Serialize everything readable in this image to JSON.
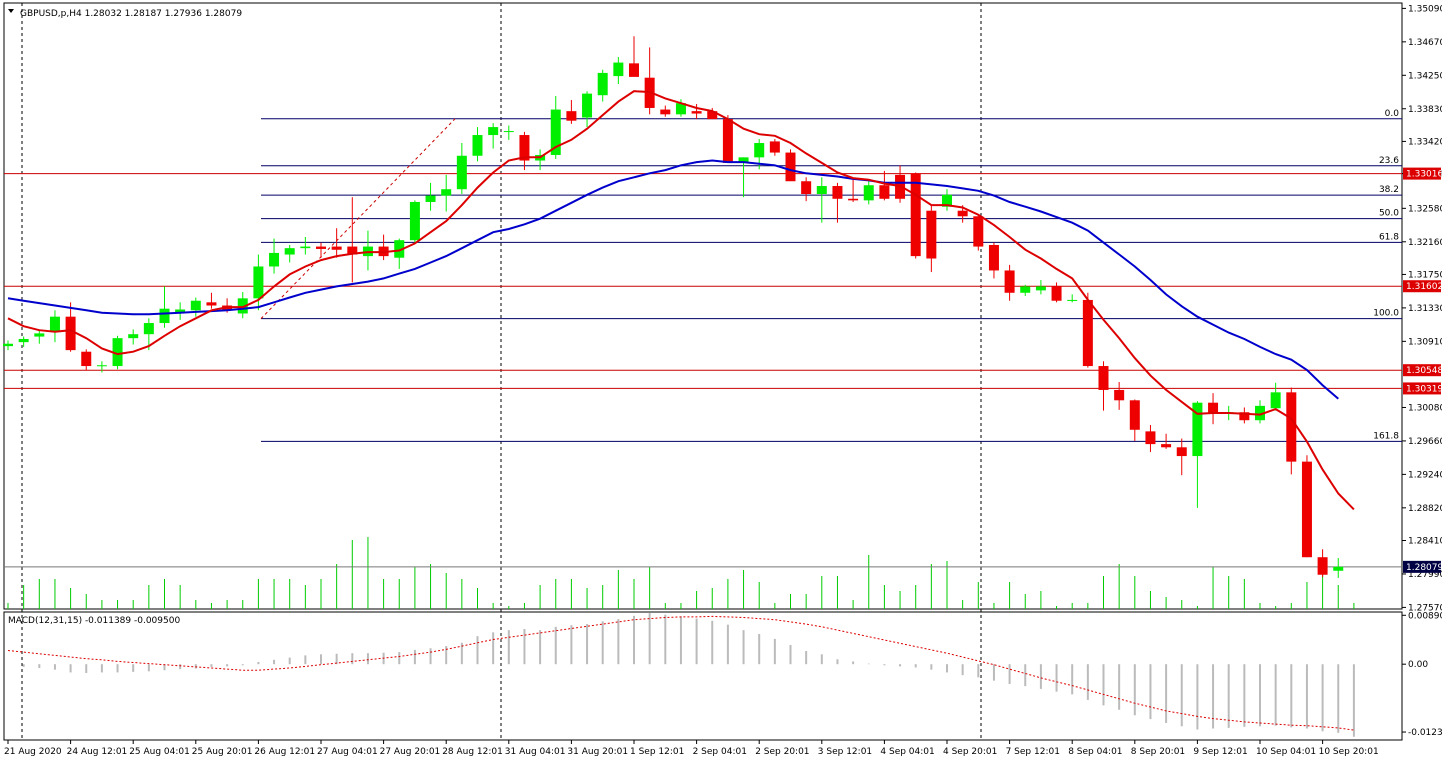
{
  "header": {
    "symbol_line": "GBPUSD,p,H4  1.28032 1.28187 1.27936 1.28079",
    "macd_line": "MACD(12,31,15) -0.011389 -0.009500"
  },
  "colors": {
    "bull": "#00ee00",
    "bear": "#ee0000",
    "ma_fast": "#dd0000",
    "ma_slow": "#0000cc",
    "fib": "#000066",
    "hline": "#cc0000",
    "volume": "#00cc00",
    "macd_hist": "#bbbbbb",
    "macd_signal": "#dd0000"
  },
  "chart_data": {
    "type": "candlestick",
    "timeframe": "H4",
    "price_axis": {
      "ticks": [
        "1.35090",
        "1.34670",
        "1.34250",
        "1.33830",
        "1.33420",
        "1.33016",
        "1.32580",
        "1.32160",
        "1.31750",
        "1.31330",
        "1.30910",
        "1.30080",
        "1.29660",
        "1.29240",
        "1.28820",
        "1.28410",
        "1.27990",
        "1.27570"
      ],
      "range": [
        1.2755,
        1.3512
      ]
    },
    "price_tags": [
      {
        "value": 1.33016,
        "label": "1.33016",
        "kind": "hline"
      },
      {
        "value": 1.31602,
        "label": "1.31602",
        "kind": "hline"
      },
      {
        "value": 1.30548,
        "label": "1.30548",
        "kind": "hline"
      },
      {
        "value": 1.30319,
        "label": "1.30319",
        "kind": "hline"
      },
      {
        "value": 1.28079,
        "label": "1.28079",
        "kind": "bid"
      }
    ],
    "fibonacci": {
      "start": 1.31195,
      "end": 1.33704,
      "levels": [
        {
          "label": "0.0",
          "value": 1.33704
        },
        {
          "label": "23.6",
          "value": 1.33114
        },
        {
          "label": "38.2",
          "value": 1.32746
        },
        {
          "label": "50.0",
          "value": 1.3245
        },
        {
          "label": "61.8",
          "value": 1.32153
        },
        {
          "label": "100.0",
          "value": 1.31195
        },
        {
          "label": "161.8",
          "value": 1.29654
        }
      ]
    },
    "x_labels": [
      {
        "label": "21 Aug 2020",
        "bar": 0
      },
      {
        "label": "24 Aug 12:01",
        "bar": 4
      },
      {
        "label": "25 Aug 04:01",
        "bar": 8
      },
      {
        "label": "25 Aug 20:01",
        "bar": 12
      },
      {
        "label": "26 Aug 12:01",
        "bar": 16
      },
      {
        "label": "27 Aug 04:01",
        "bar": 20
      },
      {
        "label": "27 Aug 20:01",
        "bar": 24
      },
      {
        "label": "28 Aug 12:01",
        "bar": 28
      },
      {
        "label": "31 Aug 04:01",
        "bar": 32
      },
      {
        "label": "31 Aug 20:01",
        "bar": 36
      },
      {
        "label": "1 Sep 12:01",
        "bar": 40
      },
      {
        "label": "2 Sep 04:01",
        "bar": 44
      },
      {
        "label": "2 Sep 20:01",
        "bar": 48
      },
      {
        "label": "3 Sep 12:01",
        "bar": 52
      },
      {
        "label": "4 Sep 04:01",
        "bar": 56
      },
      {
        "label": "4 Sep 20:01",
        "bar": 60
      },
      {
        "label": "7 Sep 12:01",
        "bar": 64
      },
      {
        "label": "8 Sep 04:01",
        "bar": 68
      },
      {
        "label": "8 Sep 20:01",
        "bar": 72
      },
      {
        "label": "9 Sep 12:01",
        "bar": 76
      },
      {
        "label": "10 Sep 04:01",
        "bar": 80
      },
      {
        "label": "10 Sep 20:01",
        "bar": 84
      }
    ],
    "candles": [
      {
        "o": 1.3085,
        "h": 1.3092,
        "l": 1.308,
        "c": 1.3088
      },
      {
        "o": 1.309,
        "h": 1.3097,
        "l": 1.3084,
        "c": 1.3094
      },
      {
        "o": 1.3097,
        "h": 1.3106,
        "l": 1.3088,
        "c": 1.3101
      },
      {
        "o": 1.3103,
        "h": 1.313,
        "l": 1.309,
        "c": 1.3122
      },
      {
        "o": 1.3122,
        "h": 1.314,
        "l": 1.3078,
        "c": 1.308
      },
      {
        "o": 1.3078,
        "h": 1.3081,
        "l": 1.3055,
        "c": 1.306
      },
      {
        "o": 1.306,
        "h": 1.3066,
        "l": 1.3052,
        "c": 1.3061
      },
      {
        "o": 1.306,
        "h": 1.3098,
        "l": 1.3056,
        "c": 1.3095
      },
      {
        "o": 1.3095,
        "h": 1.3106,
        "l": 1.3087,
        "c": 1.31
      },
      {
        "o": 1.31,
        "h": 1.312,
        "l": 1.308,
        "c": 1.3114
      },
      {
        "o": 1.3114,
        "h": 1.316,
        "l": 1.3108,
        "c": 1.3132
      },
      {
        "o": 1.3127,
        "h": 1.314,
        "l": 1.3118,
        "c": 1.3131
      },
      {
        "o": 1.313,
        "h": 1.3146,
        "l": 1.3122,
        "c": 1.3142
      },
      {
        "o": 1.314,
        "h": 1.3152,
        "l": 1.3132,
        "c": 1.3136
      },
      {
        "o": 1.3136,
        "h": 1.3145,
        "l": 1.3127,
        "c": 1.313
      },
      {
        "o": 1.3126,
        "h": 1.3153,
        "l": 1.312,
        "c": 1.3145
      },
      {
        "o": 1.3145,
        "h": 1.32,
        "l": 1.313,
        "c": 1.3185
      },
      {
        "o": 1.3185,
        "h": 1.322,
        "l": 1.3176,
        "c": 1.3202
      },
      {
        "o": 1.32,
        "h": 1.3212,
        "l": 1.319,
        "c": 1.3208
      },
      {
        "o": 1.3208,
        "h": 1.3222,
        "l": 1.32,
        "c": 1.321
      },
      {
        "o": 1.321,
        "h": 1.3215,
        "l": 1.3196,
        "c": 1.3207
      },
      {
        "o": 1.321,
        "h": 1.3233,
        "l": 1.3196,
        "c": 1.3206
      },
      {
        "o": 1.321,
        "h": 1.3272,
        "l": 1.3165,
        "c": 1.32
      },
      {
        "o": 1.3198,
        "h": 1.323,
        "l": 1.318,
        "c": 1.321
      },
      {
        "o": 1.321,
        "h": 1.3225,
        "l": 1.3193,
        "c": 1.3198
      },
      {
        "o": 1.3196,
        "h": 1.322,
        "l": 1.3182,
        "c": 1.3218
      },
      {
        "o": 1.3218,
        "h": 1.3268,
        "l": 1.3214,
        "c": 1.3266
      },
      {
        "o": 1.3266,
        "h": 1.329,
        "l": 1.3255,
        "c": 1.3274
      },
      {
        "o": 1.3274,
        "h": 1.33,
        "l": 1.3254,
        "c": 1.3282
      },
      {
        "o": 1.3282,
        "h": 1.334,
        "l": 1.3276,
        "c": 1.3324
      },
      {
        "o": 1.3324,
        "h": 1.336,
        "l": 1.3317,
        "c": 1.335
      },
      {
        "o": 1.335,
        "h": 1.3365,
        "l": 1.3333,
        "c": 1.336
      },
      {
        "o": 1.3354,
        "h": 1.3362,
        "l": 1.3344,
        "c": 1.3355
      },
      {
        "o": 1.335,
        "h": 1.3354,
        "l": 1.3306,
        "c": 1.3318
      },
      {
        "o": 1.3318,
        "h": 1.3332,
        "l": 1.3306,
        "c": 1.3325
      },
      {
        "o": 1.3325,
        "h": 1.3399,
        "l": 1.332,
        "c": 1.3382
      },
      {
        "o": 1.338,
        "h": 1.3394,
        "l": 1.3364,
        "c": 1.3368
      },
      {
        "o": 1.3372,
        "h": 1.3405,
        "l": 1.336,
        "c": 1.3402
      },
      {
        "o": 1.34,
        "h": 1.3432,
        "l": 1.3392,
        "c": 1.3428
      },
      {
        "o": 1.3424,
        "h": 1.3448,
        "l": 1.3414,
        "c": 1.3441
      },
      {
        "o": 1.344,
        "h": 1.3474,
        "l": 1.3432,
        "c": 1.3423
      },
      {
        "o": 1.3422,
        "h": 1.346,
        "l": 1.3376,
        "c": 1.3384
      },
      {
        "o": 1.3382,
        "h": 1.3387,
        "l": 1.3373,
        "c": 1.3376
      },
      {
        "o": 1.3376,
        "h": 1.3395,
        "l": 1.3373,
        "c": 1.339
      },
      {
        "o": 1.338,
        "h": 1.3389,
        "l": 1.337,
        "c": 1.3377
      },
      {
        "o": 1.338,
        "h": 1.3384,
        "l": 1.337,
        "c": 1.337
      },
      {
        "o": 1.337,
        "h": 1.3375,
        "l": 1.332,
        "c": 1.3315
      },
      {
        "o": 1.3315,
        "h": 1.3322,
        "l": 1.3272,
        "c": 1.3322
      },
      {
        "o": 1.3322,
        "h": 1.3345,
        "l": 1.3307,
        "c": 1.334
      },
      {
        "o": 1.3342,
        "h": 1.3345,
        "l": 1.3324,
        "c": 1.3328
      },
      {
        "o": 1.3328,
        "h": 1.3332,
        "l": 1.3294,
        "c": 1.3292
      },
      {
        "o": 1.3292,
        "h": 1.3297,
        "l": 1.3267,
        "c": 1.3276
      },
      {
        "o": 1.3276,
        "h": 1.3297,
        "l": 1.324,
        "c": 1.3286
      },
      {
        "o": 1.3286,
        "h": 1.329,
        "l": 1.324,
        "c": 1.327
      },
      {
        "o": 1.327,
        "h": 1.3295,
        "l": 1.3266,
        "c": 1.3268
      },
      {
        "o": 1.3268,
        "h": 1.3292,
        "l": 1.3263,
        "c": 1.3287
      },
      {
        "o": 1.3287,
        "h": 1.3305,
        "l": 1.3268,
        "c": 1.327
      },
      {
        "o": 1.33,
        "h": 1.3312,
        "l": 1.3265,
        "c": 1.327
      },
      {
        "o": 1.3302,
        "h": 1.3303,
        "l": 1.3195,
        "c": 1.3198
      },
      {
        "o": 1.3255,
        "h": 1.3262,
        "l": 1.3178,
        "c": 1.3195
      },
      {
        "o": 1.326,
        "h": 1.3282,
        "l": 1.3255,
        "c": 1.3275
      },
      {
        "o": 1.3255,
        "h": 1.3262,
        "l": 1.324,
        "c": 1.3248
      },
      {
        "o": 1.3248,
        "h": 1.325,
        "l": 1.3205,
        "c": 1.321
      },
      {
        "o": 1.3212,
        "h": 1.3215,
        "l": 1.317,
        "c": 1.318
      },
      {
        "o": 1.318,
        "h": 1.3187,
        "l": 1.3142,
        "c": 1.3152
      },
      {
        "o": 1.3152,
        "h": 1.3162,
        "l": 1.3148,
        "c": 1.316
      },
      {
        "o": 1.3155,
        "h": 1.3168,
        "l": 1.315,
        "c": 1.316
      },
      {
        "o": 1.316,
        "h": 1.3165,
        "l": 1.314,
        "c": 1.3142
      },
      {
        "o": 1.3142,
        "h": 1.315,
        "l": 1.314,
        "c": 1.3143
      },
      {
        "o": 1.3143,
        "h": 1.3152,
        "l": 1.3058,
        "c": 1.306
      },
      {
        "o": 1.306,
        "h": 1.3066,
        "l": 1.3004,
        "c": 1.303
      },
      {
        "o": 1.303,
        "h": 1.304,
        "l": 1.3005,
        "c": 1.3017
      },
      {
        "o": 1.3017,
        "h": 1.3018,
        "l": 1.2966,
        "c": 1.298
      },
      {
        "o": 1.2978,
        "h": 1.2986,
        "l": 1.2952,
        "c": 1.2962
      },
      {
        "o": 1.2962,
        "h": 1.2975,
        "l": 1.2956,
        "c": 1.2958
      },
      {
        "o": 1.2958,
        "h": 1.2969,
        "l": 1.2923,
        "c": 1.2947
      },
      {
        "o": 1.2947,
        "h": 1.3016,
        "l": 1.2882,
        "c": 1.3014
      },
      {
        "o": 1.3014,
        "h": 1.3026,
        "l": 1.2987,
        "c": 1.3
      },
      {
        "o": 1.3,
        "h": 1.301,
        "l": 1.2992,
        "c": 1.3002
      },
      {
        "o": 1.3002,
        "h": 1.3008,
        "l": 1.2988,
        "c": 1.2992
      },
      {
        "o": 1.2992,
        "h": 1.3017,
        "l": 1.2988,
        "c": 1.301
      },
      {
        "o": 1.3007,
        "h": 1.3039,
        "l": 1.3004,
        "c": 1.3027
      },
      {
        "o": 1.3027,
        "h": 1.3033,
        "l": 1.2924,
        "c": 1.294
      },
      {
        "o": 1.294,
        "h": 1.2948,
        "l": 1.282,
        "c": 1.282
      },
      {
        "o": 1.282,
        "h": 1.283,
        "l": 1.2795,
        "c": 1.2798
      },
      {
        "o": 1.2803,
        "h": 1.2819,
        "l": 1.2794,
        "c": 1.2808
      }
    ],
    "volume": [
      2,
      8,
      10,
      10,
      7,
      5,
      3,
      3,
      3,
      8,
      10,
      8,
      3,
      2,
      3,
      3,
      10,
      10,
      10,
      8,
      10,
      15,
      23,
      24,
      10,
      10,
      14,
      15,
      12,
      10,
      7,
      2,
      1,
      2,
      8,
      10,
      10,
      7,
      8,
      13,
      10,
      14,
      2,
      2,
      6,
      7,
      10,
      13,
      9,
      2,
      5,
      5,
      11,
      11,
      3,
      18,
      8,
      6,
      8,
      15,
      16,
      3,
      9,
      2,
      9,
      5,
      6,
      1,
      2,
      2,
      11,
      15,
      11,
      6,
      4,
      3,
      1,
      14,
      11,
      10,
      2,
      1,
      2,
      9,
      16,
      8,
      2
    ],
    "ma_fast": [
      1.312,
      1.311,
      1.3105,
      1.3103,
      1.3105,
      1.3095,
      1.3082,
      1.3075,
      1.3078,
      1.3085,
      1.3098,
      1.311,
      1.312,
      1.313,
      1.3134,
      1.3134,
      1.3143,
      1.316,
      1.3175,
      1.3185,
      1.3193,
      1.3198,
      1.3201,
      1.3203,
      1.3203,
      1.3205,
      1.3214,
      1.3228,
      1.3242,
      1.3262,
      1.3284,
      1.3303,
      1.3318,
      1.3322,
      1.3322,
      1.3335,
      1.3344,
      1.3358,
      1.3375,
      1.3392,
      1.3405,
      1.3404,
      1.3396,
      1.339,
      1.3384,
      1.338,
      1.337,
      1.3358,
      1.3351,
      1.3349,
      1.334,
      1.3327,
      1.3315,
      1.3303,
      1.3296,
      1.3294,
      1.3289,
      1.3286,
      1.3275,
      1.3262,
      1.3262,
      1.3259,
      1.325,
      1.3237,
      1.3222,
      1.3206,
      1.3195,
      1.3182,
      1.317,
      1.3143,
      1.3118,
      1.3095,
      1.307,
      1.3048,
      1.303,
      1.3015,
      1.3,
      1.3001,
      1.3001,
      1.3,
      1.2999,
      1.3006,
      1.2994,
      1.2965,
      1.293,
      1.29,
      1.288
    ],
    "ma_slow": [
      1.3145,
      1.3142,
      1.3139,
      1.3136,
      1.3133,
      1.313,
      1.3127,
      1.3126,
      1.3125,
      1.3125,
      1.3126,
      1.3127,
      1.3128,
      1.3129,
      1.313,
      1.3132,
      1.3134,
      1.314,
      1.3146,
      1.3152,
      1.3156,
      1.316,
      1.3163,
      1.3166,
      1.317,
      1.3176,
      1.3182,
      1.319,
      1.3198,
      1.3208,
      1.3218,
      1.3228,
      1.3232,
      1.3238,
      1.3245,
      1.3255,
      1.3265,
      1.3275,
      1.3284,
      1.3292,
      1.3297,
      1.3302,
      1.3306,
      1.3312,
      1.3316,
      1.3318,
      1.3316,
      1.3316,
      1.3314,
      1.3312,
      1.3306,
      1.3302,
      1.33,
      1.3298,
      1.3295,
      1.3293,
      1.329,
      1.329,
      1.329,
      1.3288,
      1.3286,
      1.3283,
      1.328,
      1.3274,
      1.3266,
      1.326,
      1.3254,
      1.3247,
      1.324,
      1.323,
      1.3215,
      1.32,
      1.3185,
      1.3168,
      1.315,
      1.3135,
      1.3122,
      1.3112,
      1.3102,
      1.3094,
      1.3084,
      1.3075,
      1.3068,
      1.3055,
      1.3036,
      1.3019
    ],
    "macd": {
      "ticks": [
        "0.008901",
        "0.00",
        "-0.01235"
      ],
      "range": [
        -0.0138,
        0.0095
      ],
      "hist": [
        0,
        -0.0005,
        -0.0007,
        -0.001,
        -0.0015,
        -0.0016,
        -0.0015,
        -0.0015,
        -0.0014,
        -0.0013,
        -0.0011,
        -0.0009,
        -0.0008,
        -0.0005,
        -0.0004,
        -0.0002,
        0.0004,
        0.0008,
        0.0012,
        0.0016,
        0.0018,
        0.0019,
        0.002,
        0.002,
        0.0021,
        0.0022,
        0.0026,
        0.0029,
        0.0033,
        0.0039,
        0.0051,
        0.0058,
        0.0062,
        0.0064,
        0.0062,
        0.0068,
        0.0071,
        0.0073,
        0.0078,
        0.0082,
        0.0088,
        0.0093,
        0.009,
        0.0087,
        0.0083,
        0.0079,
        0.0072,
        0.0062,
        0.0055,
        0.0046,
        0.0035,
        0.0024,
        0.0018,
        0.0009,
        0.0005,
        0.0001,
        -0.0002,
        -0.0004,
        -0.0006,
        -0.001,
        -0.0015,
        -0.002,
        -0.0024,
        -0.003,
        -0.0036,
        -0.004,
        -0.0045,
        -0.005,
        -0.0055,
        -0.0065,
        -0.0075,
        -0.0083,
        -0.0093,
        -0.01,
        -0.0107,
        -0.0113,
        -0.0119,
        -0.0117,
        -0.0116,
        -0.0114,
        -0.0113,
        -0.0112,
        -0.0115,
        -0.0117,
        -0.0122,
        -0.0125,
        -0.0132
      ],
      "signal": [
        0.0025,
        0.0022,
        0.0019,
        0.0016,
        0.0013,
        0.001,
        0.0008,
        0.0005,
        0.0003,
        0.0001,
        -0.0001,
        -0.0003,
        -0.0005,
        -0.0007,
        -0.0009,
        -0.0011,
        -0.0011,
        -0.0009,
        -0.0007,
        -0.0004,
        -0.0001,
        0.0002,
        0.0005,
        0.0008,
        0.0011,
        0.0014,
        0.0018,
        0.0022,
        0.0027,
        0.0033,
        0.0039,
        0.0045,
        0.0049,
        0.0053,
        0.0057,
        0.0061,
        0.0065,
        0.0069,
        0.0073,
        0.0077,
        0.0081,
        0.0083,
        0.0085,
        0.0086,
        0.0086,
        0.0087,
        0.0086,
        0.0085,
        0.0083,
        0.0081,
        0.0077,
        0.0073,
        0.0068,
        0.0062,
        0.0056,
        0.005,
        0.0044,
        0.0038,
        0.0032,
        0.0026,
        0.002,
        0.0013,
        0.0006,
        -0.0001,
        -0.0009,
        -0.0017,
        -0.0025,
        -0.0032,
        -0.0039,
        -0.0047,
        -0.0055,
        -0.0063,
        -0.0071,
        -0.0078,
        -0.0085,
        -0.009,
        -0.0095,
        -0.0099,
        -0.0102,
        -0.0105,
        -0.0107,
        -0.0109,
        -0.0111,
        -0.0112,
        -0.0114,
        -0.0116,
        -0.012
      ]
    }
  }
}
